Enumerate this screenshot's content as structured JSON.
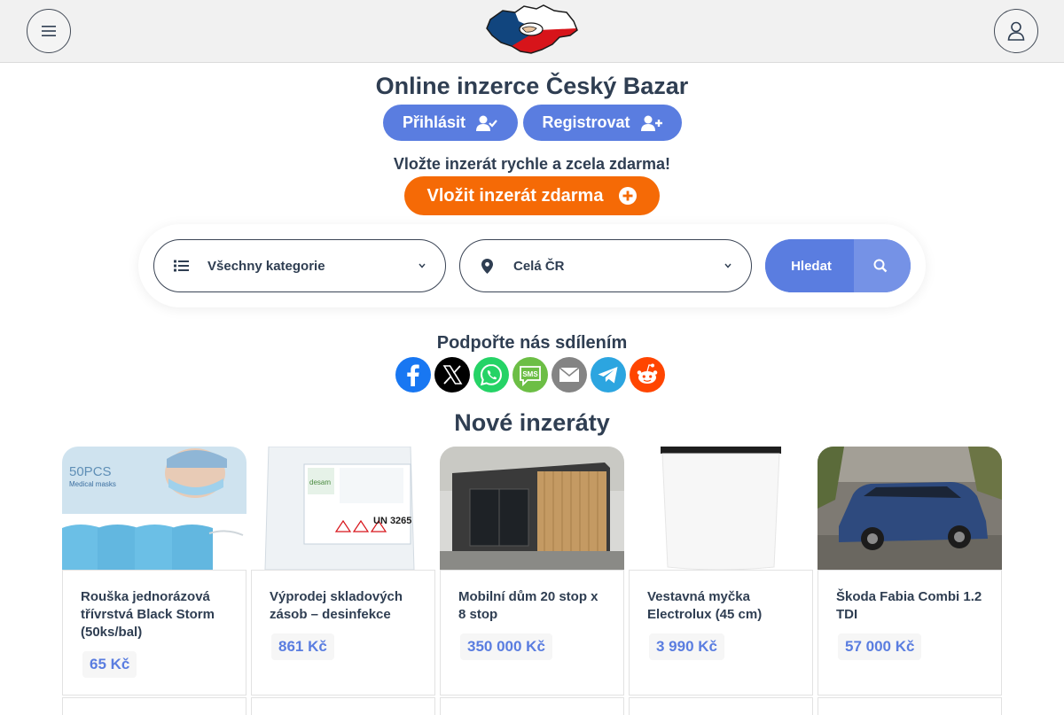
{
  "header": {
    "menu_icon": "hamburger-icon",
    "user_icon": "user-icon",
    "logo_icon": "czech-map-handshake-logo"
  },
  "hero": {
    "headline": "Online inzerce Český Bazar",
    "login_label": "Přihlásit",
    "register_label": "Registrovat",
    "tagline": "Vložte inzerát rychle a zcela zdarma!",
    "cta_label": "Vložit inzerát zdarma"
  },
  "search": {
    "category_value": "Všechny kategorie",
    "location_value": "Celá ČR",
    "button_label": "Hledat"
  },
  "share": {
    "title": "Podpořte nás sdílením",
    "buttons": [
      "Facebook",
      "X",
      "Whatsapp",
      "SMS",
      "Email",
      "Telegram",
      "Reddit"
    ]
  },
  "listings": {
    "title": "Nové inzeráty",
    "items": [
      {
        "title": "Rouška jednorázová třívrstvá Black Storm (50ks/bal)",
        "price": "65 Kč",
        "image_text": "50PCS",
        "image_subtext": "Medical masks"
      },
      {
        "title": "Výprodej skladových zásob – desinfekce",
        "price": "861 Kč",
        "image_text": "UN 3265",
        "image_subtext": "desam"
      },
      {
        "title": "Mobilní dům 20 stop x 8 stop",
        "price": "350 000 Kč"
      },
      {
        "title": "Vestavná myčka Electrolux (45 cm)",
        "price": "3 990 Kč"
      },
      {
        "title": "Škoda Fabia Combi 1.2 TDI",
        "price": "57 000 Kč"
      }
    ]
  },
  "colors": {
    "primary": "#5a7de0",
    "cta": "#f56a06",
    "text": "#2f3e52",
    "header_bg": "#f1f1f1"
  }
}
